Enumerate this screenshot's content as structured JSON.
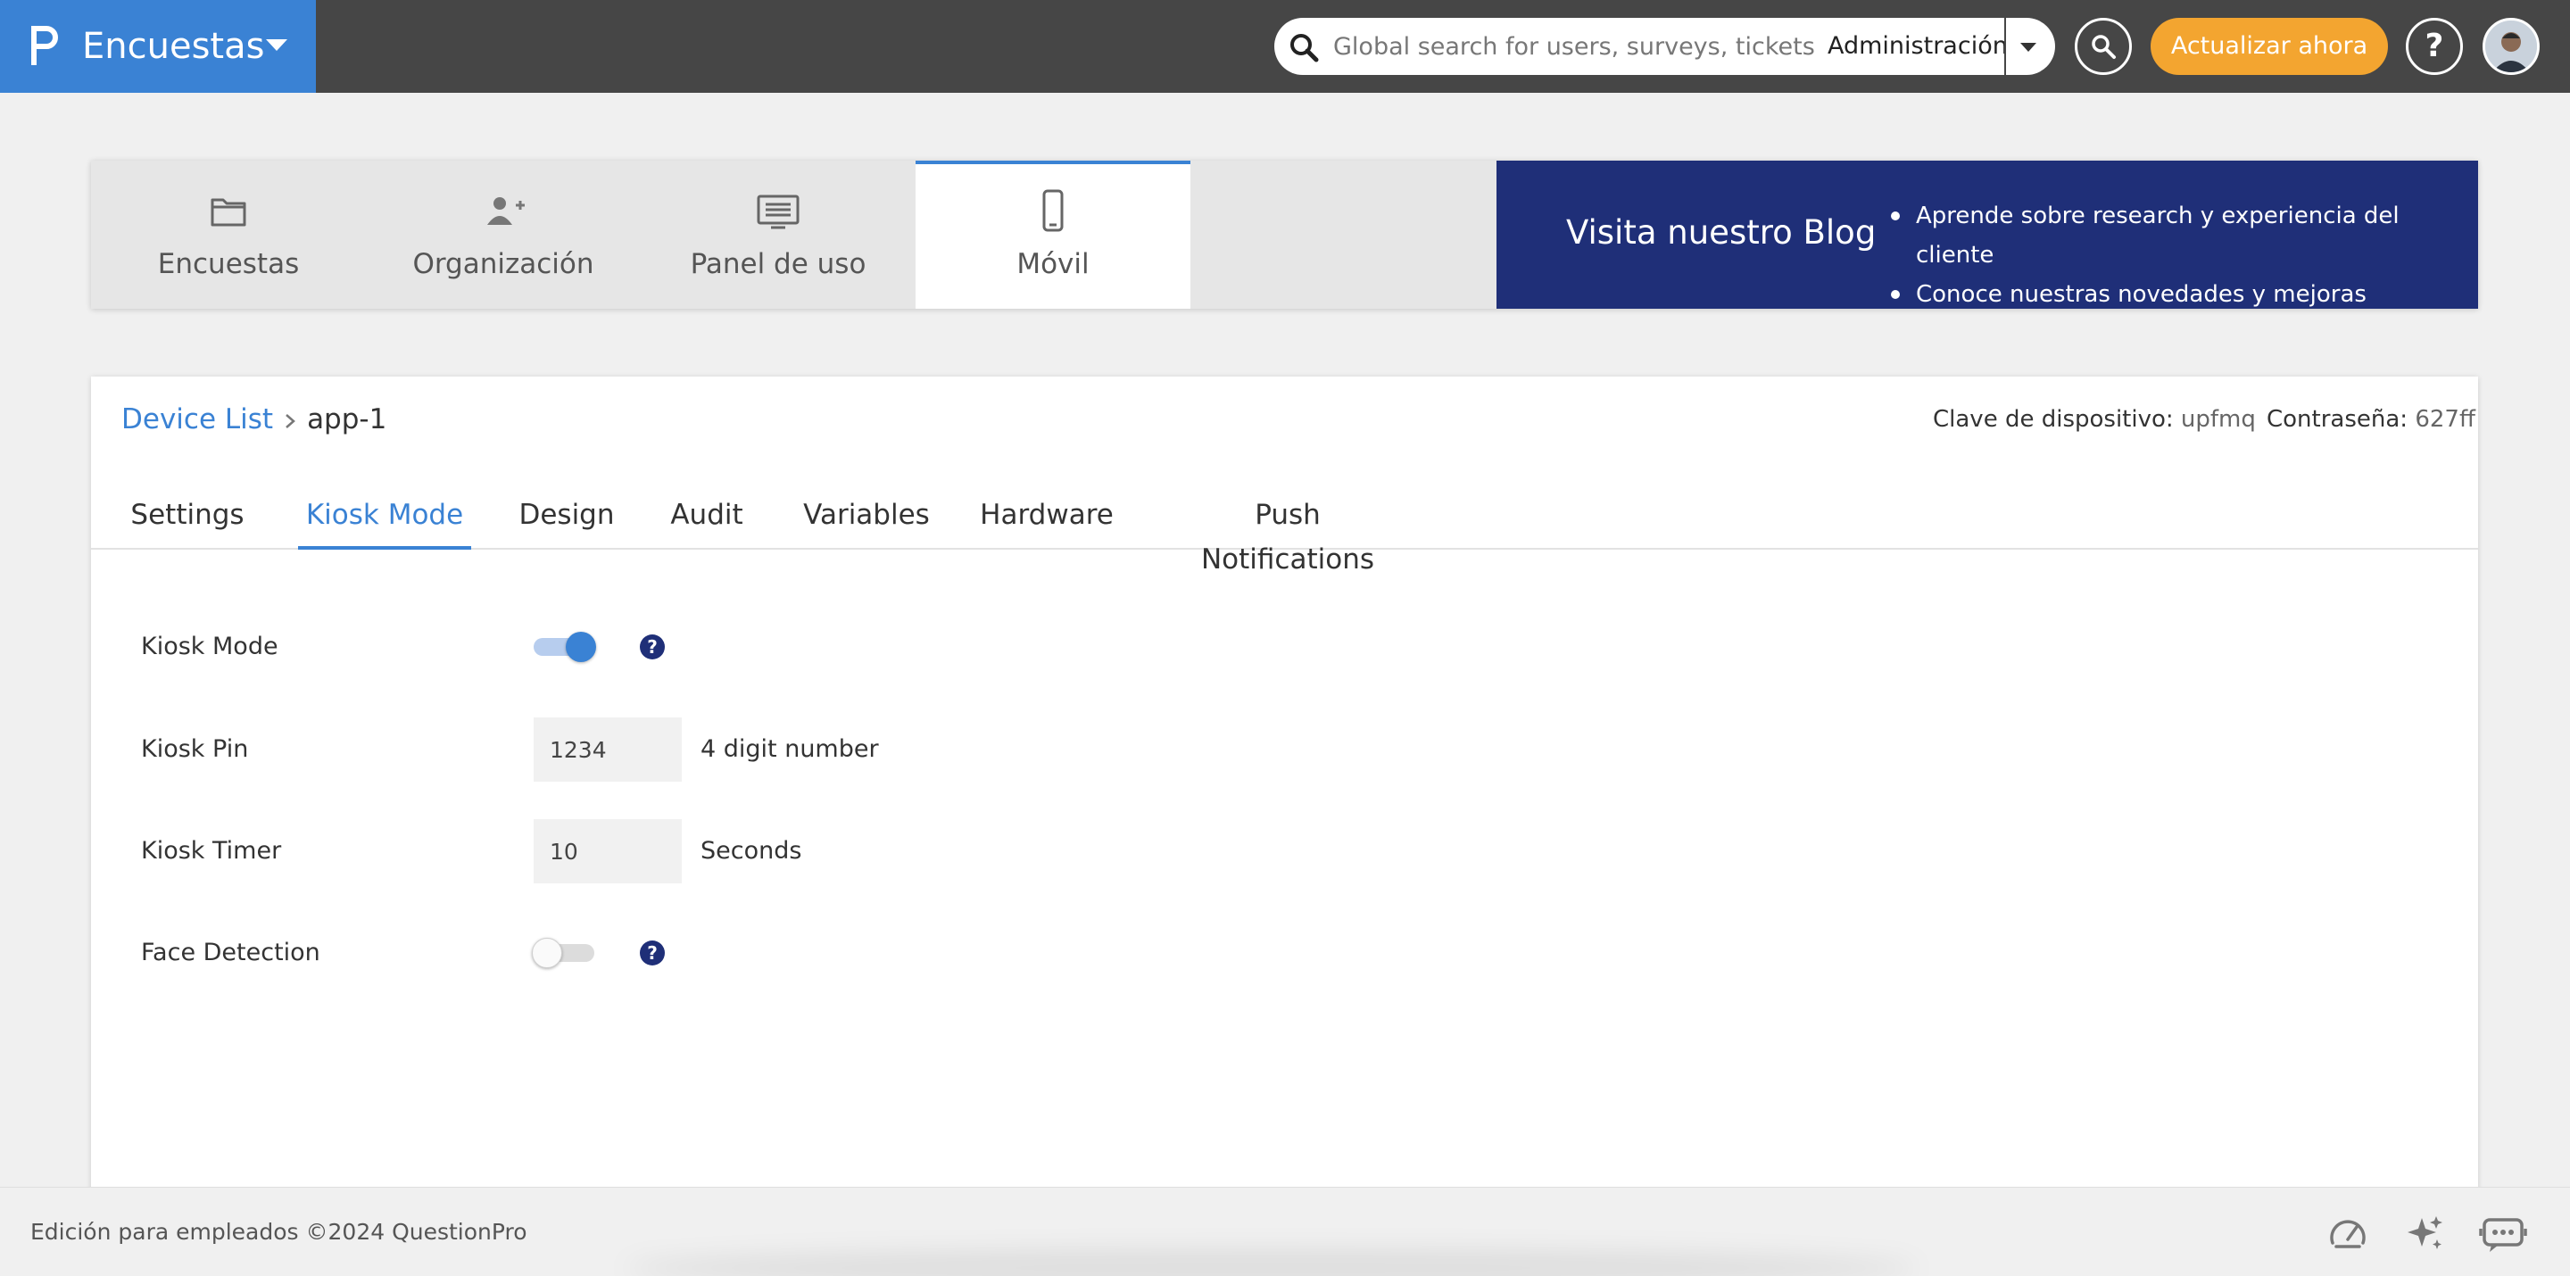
{
  "topbar": {
    "brand_title": "Encuestas",
    "search_placeholder": "Global search for users, surveys, tickets",
    "search_scope": "Administración",
    "upgrade_label": "Actualizar ahora",
    "help_label": "?",
    "brand_color": "#3a82d4",
    "bar_color": "#464646",
    "upgrade_color": "#f3a530"
  },
  "nav": {
    "tabs": [
      {
        "label": "Encuestas",
        "icon": "folder-icon"
      },
      {
        "label": "Organización",
        "icon": "user-add-icon"
      },
      {
        "label": "Panel de uso",
        "icon": "monitor-icon"
      },
      {
        "label": "Móvil",
        "icon": "mobile-phone-icon",
        "active": true
      }
    ],
    "blog": {
      "title": "Visita nuestro Blog",
      "items": [
        "Aprende sobre research y experiencia del cliente",
        "Conoce nuestras novedades y mejoras"
      ],
      "color": "#1f2f78"
    }
  },
  "device": {
    "breadcrumb": {
      "parent": "Device List",
      "current": "app-1"
    },
    "key_label": "Clave de dispositivo:",
    "key_value": "upfmq",
    "password_label": "Contraseña:",
    "password_value": "627ff"
  },
  "tabs": [
    {
      "label": "Settings"
    },
    {
      "label": "Kiosk Mode",
      "active": true
    },
    {
      "label": "Design"
    },
    {
      "label": "Audit"
    },
    {
      "label": "Variables"
    },
    {
      "label": "Hardware"
    },
    {
      "label": "Push Notifications"
    }
  ],
  "kiosk": {
    "mode_label": "Kiosk Mode",
    "mode_enabled": true,
    "pin_label": "Kiosk Pin",
    "pin_value": "1234",
    "pin_hint": "4 digit number",
    "timer_label": "Kiosk Timer",
    "timer_value": "10",
    "timer_hint": "Seconds",
    "face_label": "Face Detection",
    "face_enabled": false,
    "help_label": "?"
  },
  "footer": {
    "text": "Edición para empleados ©2024 QuestionPro",
    "icons": [
      "speedometer-icon",
      "sparkles-icon",
      "chat-bot-icon"
    ]
  }
}
